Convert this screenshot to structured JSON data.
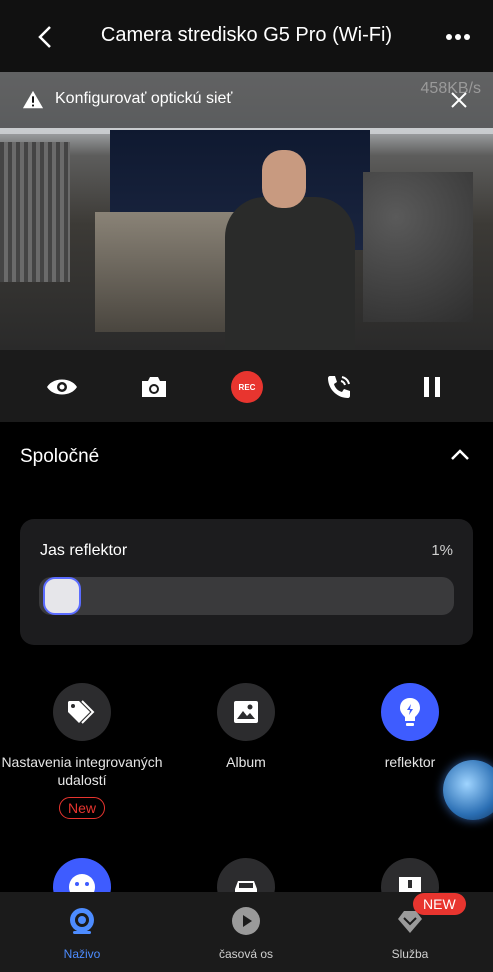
{
  "header": {
    "title": "Camera stredisko G5 Pro (Wi-Fi)"
  },
  "video": {
    "banner_text": "Konfigurovať optickú sieť",
    "speed": "458KB/s"
  },
  "controls": {
    "rec_label": "REC"
  },
  "section": {
    "title": "Spoločné"
  },
  "brightness": {
    "label": "Jas reflektor",
    "value_text": "1%",
    "value": 0.01
  },
  "grid": {
    "items": [
      {
        "label": "Nastavenia integrovaných udalostí",
        "badge": "New",
        "icon": "tag-icon"
      },
      {
        "label": "Album",
        "icon": "image-icon"
      },
      {
        "label": "reflektor",
        "icon": "bulb-icon",
        "active": true
      }
    ]
  },
  "nav": {
    "items": [
      {
        "label": "Naživo",
        "active": true,
        "icon": "live-camera-icon"
      },
      {
        "label": "časová os",
        "icon": "play-icon"
      },
      {
        "label": "Služba",
        "icon": "service-diamond-icon"
      }
    ],
    "service_badge": "NEW"
  },
  "colors": {
    "accent": "#3e5cff",
    "rec": "#e8352f",
    "nav_active": "#4d8cff"
  }
}
